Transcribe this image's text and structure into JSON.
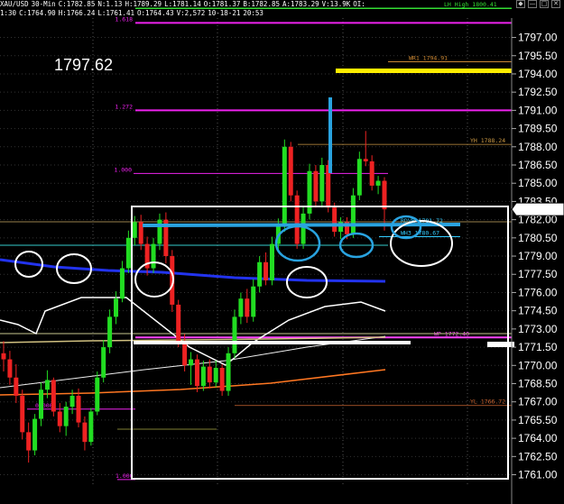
{
  "header": {
    "symbol": "XAU/USD",
    "timeframe": "30-Min",
    "close": "C:1782.85",
    "net": "N:1.13",
    "high": "H:1789.29",
    "low": "L:1781.14",
    "open": "O:1781.37",
    "bid": "B:1782.85",
    "ask": "A:1783.29",
    "volume": "V:13.9K",
    "oi": "OI:"
  },
  "subheader": {
    "time": "1:30",
    "close": "C:1764.90",
    "high": "H:1766.24",
    "low": "L:1761.41",
    "open": "O:1764.43",
    "volume": "V:2,572",
    "date": "10-18-21",
    "clock": "20:53"
  },
  "window_buttons": [
    "◆",
    "—",
    "□",
    "✕"
  ],
  "big_price": "1797.62",
  "chart_data": {
    "type": "line",
    "y_axis_labels": [
      "1797.00",
      "1795.50",
      "1794.00",
      "1792.50",
      "1791.00",
      "1789.50",
      "1788.00",
      "1786.50",
      "1785.00",
      "1783.50",
      "1782.00",
      "1780.50",
      "1779.00",
      "1777.50",
      "1776.00",
      "1774.50",
      "1773.00",
      "1771.50",
      "1770.00",
      "1768.50",
      "1767.00",
      "1765.50",
      "1764.00",
      "1762.50",
      "1761.00"
    ],
    "ylim": [
      1760.0,
      1798.6
    ],
    "current_price": "1782.85",
    "levels": [
      {
        "label": "LH High 1800.41",
        "price": 1799.4,
        "color": "#33dd33"
      },
      {
        "label": "1.618",
        "price": 1798.2,
        "color": "#ee22ee"
      },
      {
        "label": "WR1 1794.91",
        "price": 1795.0,
        "color": "#cc8833"
      },
      {
        "label": "1.272",
        "price": 1791.0,
        "color": "#ee22ee"
      },
      {
        "label": "YH 1788.24",
        "price": 1788.2,
        "color": "#cc9944"
      },
      {
        "label": "1.000",
        "price": 1785.8,
        "color": "#ee22ee"
      },
      {
        "label": "RDVR 1781.72",
        "price": 1781.6,
        "color": "#33ccff"
      },
      {
        "label": "WH3 1780.67",
        "price": 1780.6,
        "color": "#33ccff"
      },
      {
        "label": "WP 1772.40",
        "price": 1772.3,
        "color": "#ff44ff"
      },
      {
        "label": "YL 1766.72",
        "price": 1766.7,
        "color": "#cc6633"
      },
      {
        "label": "0.000",
        "price": 1766.4,
        "color": "#ee22ee"
      },
      {
        "label": "1.000",
        "price": 1760.6,
        "color": "#ee22ee"
      }
    ],
    "candles": [
      [
        1771.0,
        1772.0,
        1769.5,
        1770.5
      ],
      [
        1770.5,
        1771.2,
        1768.4,
        1769.0
      ],
      [
        1769.0,
        1770.1,
        1766.9,
        1767.5
      ],
      [
        1767.5,
        1768.0,
        1763.9,
        1764.5
      ],
      [
        1764.5,
        1765.3,
        1762.0,
        1763.0
      ],
      [
        1763.0,
        1766.0,
        1762.6,
        1765.6
      ],
      [
        1765.6,
        1768.6,
        1765.0,
        1768.0
      ],
      [
        1768.0,
        1769.6,
        1767.3,
        1768.8
      ],
      [
        1768.8,
        1769.0,
        1765.8,
        1766.2
      ],
      [
        1766.2,
        1766.9,
        1764.5,
        1765.0
      ],
      [
        1765.0,
        1767.0,
        1764.2,
        1766.6
      ],
      [
        1766.6,
        1768.0,
        1766.0,
        1767.5
      ],
      [
        1767.5,
        1768.1,
        1764.9,
        1765.3
      ],
      [
        1765.3,
        1765.8,
        1763.0,
        1763.7
      ],
      [
        1763.7,
        1766.5,
        1763.4,
        1766.2
      ],
      [
        1766.2,
        1769.5,
        1765.9,
        1769.0
      ],
      [
        1769.0,
        1772.1,
        1768.6,
        1771.5
      ],
      [
        1771.5,
        1774.6,
        1771.0,
        1774.0
      ],
      [
        1774.0,
        1776.1,
        1773.4,
        1775.5
      ],
      [
        1775.5,
        1778.6,
        1775.2,
        1778.0
      ],
      [
        1778.0,
        1781.1,
        1777.6,
        1780.5
      ],
      [
        1780.5,
        1782.3,
        1779.9,
        1781.8
      ],
      [
        1781.8,
        1782.4,
        1779.5,
        1780.0
      ],
      [
        1780.0,
        1780.6,
        1777.4,
        1778.0
      ],
      [
        1778.0,
        1780.5,
        1777.6,
        1780.0
      ],
      [
        1780.0,
        1782.5,
        1779.5,
        1782.0
      ],
      [
        1782.0,
        1782.6,
        1778.4,
        1779.0
      ],
      [
        1779.0,
        1779.5,
        1774.4,
        1775.0
      ],
      [
        1775.0,
        1775.4,
        1771.5,
        1772.0
      ],
      [
        1772.0,
        1772.6,
        1769.5,
        1770.0
      ],
      [
        1770.0,
        1771.1,
        1768.4,
        1770.5
      ],
      [
        1770.5,
        1770.9,
        1767.8,
        1768.3
      ],
      [
        1768.3,
        1770.4,
        1767.9,
        1769.9
      ],
      [
        1769.9,
        1770.5,
        1768.1,
        1768.6
      ],
      [
        1768.6,
        1770.4,
        1768.2,
        1769.8
      ],
      [
        1769.8,
        1770.1,
        1767.5,
        1767.9
      ],
      [
        1767.9,
        1771.5,
        1767.5,
        1771.0
      ],
      [
        1771.0,
        1774.6,
        1770.6,
        1774.0
      ],
      [
        1774.0,
        1776.0,
        1773.4,
        1775.5
      ],
      [
        1775.5,
        1776.3,
        1773.5,
        1774.0
      ],
      [
        1774.0,
        1777.1,
        1773.6,
        1776.5
      ],
      [
        1776.5,
        1779.0,
        1776.0,
        1778.5
      ],
      [
        1778.5,
        1779.3,
        1776.6,
        1777.0
      ],
      [
        1777.0,
        1780.6,
        1776.6,
        1780.0
      ],
      [
        1780.0,
        1782.1,
        1779.4,
        1781.5
      ],
      [
        1781.5,
        1788.6,
        1781.0,
        1788.0
      ],
      [
        1788.0,
        1788.4,
        1783.5,
        1784.0
      ],
      [
        1784.0,
        1784.4,
        1779.6,
        1780.0
      ],
      [
        1780.0,
        1783.1,
        1779.6,
        1782.5
      ],
      [
        1782.5,
        1786.6,
        1782.0,
        1786.0
      ],
      [
        1786.0,
        1786.5,
        1783.0,
        1783.5
      ],
      [
        1783.5,
        1787.1,
        1783.0,
        1786.5
      ],
      [
        1786.5,
        1786.9,
        1782.6,
        1783.0
      ],
      [
        1783.0,
        1783.4,
        1780.6,
        1781.0
      ],
      [
        1781.0,
        1782.2,
        1780.4,
        1781.8
      ],
      [
        1781.8,
        1782.2,
        1780.4,
        1780.8
      ],
      [
        1780.8,
        1784.6,
        1780.5,
        1784.0
      ],
      [
        1784.0,
        1787.6,
        1783.6,
        1787.0
      ],
      [
        1787.0,
        1789.3,
        1786.4,
        1786.8
      ],
      [
        1786.8,
        1787.3,
        1784.4,
        1784.8
      ],
      [
        1784.8,
        1785.6,
        1784.1,
        1785.2
      ],
      [
        1785.2,
        1785.5,
        1781.1,
        1782.85
      ]
    ]
  },
  "annotations": {
    "ovals_white": 6,
    "ovals_blue": 4
  }
}
